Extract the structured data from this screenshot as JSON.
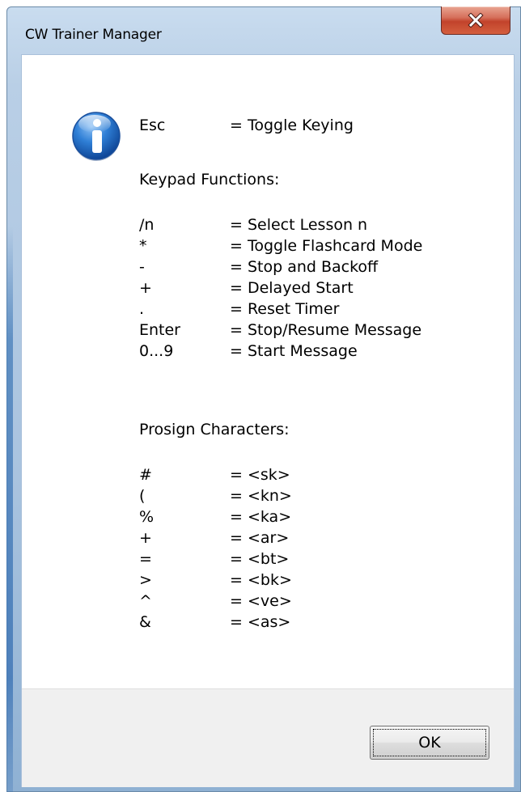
{
  "window": {
    "title": "CW Trainer Manager"
  },
  "icons": {
    "close": "close-icon",
    "info": "information-icon"
  },
  "message": {
    "esc": {
      "key": "Esc",
      "desc": "= Toggle Keying"
    },
    "keypad_heading": "Keypad Functions:",
    "keypad": [
      {
        "key": "/n",
        "desc": "= Select Lesson n"
      },
      {
        "key": "*",
        "desc": "= Toggle Flashcard Mode"
      },
      {
        "key": "-",
        "desc": "= Stop and Backoff"
      },
      {
        "key": "+",
        "desc": "= Delayed Start"
      },
      {
        "key": ".",
        "desc": "= Reset Timer"
      },
      {
        "key": "Enter",
        "desc": "= Stop/Resume Message"
      },
      {
        "key": "0...9",
        "desc": "= Start Message"
      }
    ],
    "prosign_heading": "Prosign Characters:",
    "prosigns": [
      {
        "key": "#",
        "desc": "= <sk>"
      },
      {
        "key": "(",
        "desc": "= <kn>"
      },
      {
        "key": "%",
        "desc": "= <ka>"
      },
      {
        "key": "+",
        "desc": "= <ar>"
      },
      {
        "key": "=",
        "desc": "= <bt>"
      },
      {
        "key": ">",
        "desc": "= <bk>"
      },
      {
        "key": "^",
        "desc": "= <ve>"
      },
      {
        "key": "&",
        "desc": "= <as>"
      }
    ]
  },
  "buttons": {
    "ok_label": "OK"
  },
  "colors": {
    "frame": "#b9cfe6",
    "close_button": "#c2432b",
    "info_icon": "#1f5fb8",
    "footer": "#f0f0f0"
  }
}
